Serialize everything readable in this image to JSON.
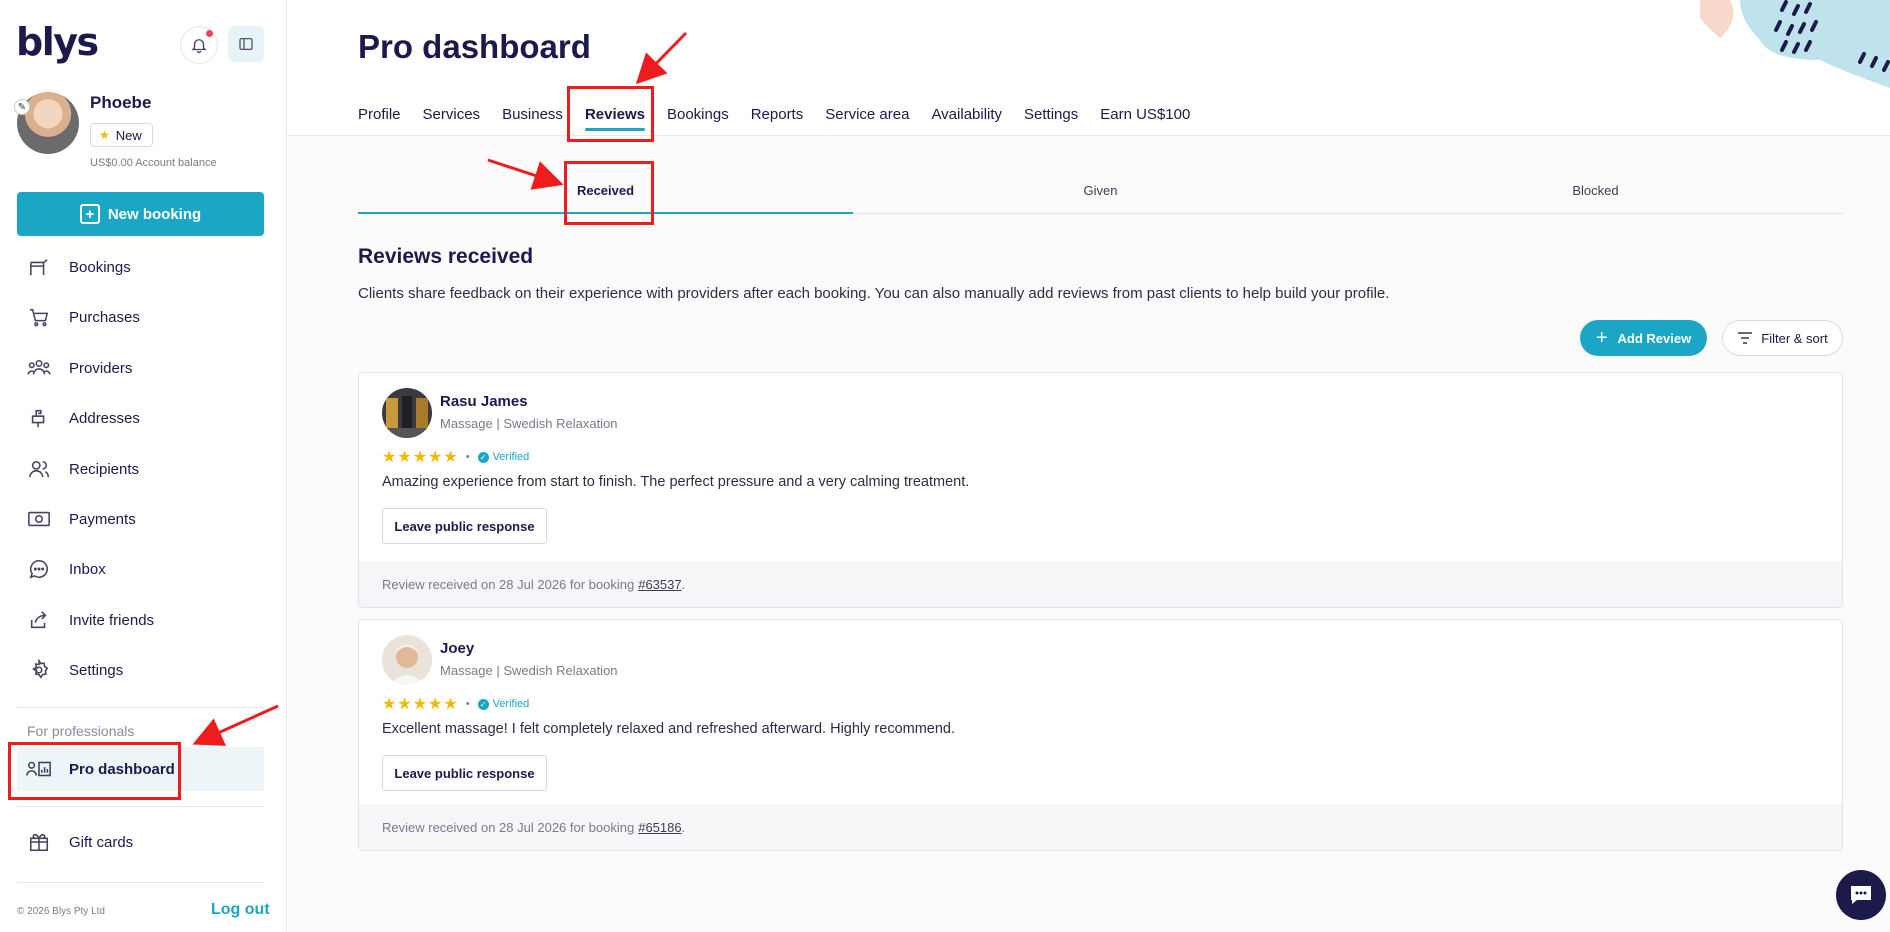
{
  "brand": {
    "logo_text": "blys",
    "accent_color": "#1aa6c4",
    "navy_color": "#1b1a4a"
  },
  "header_actions": {
    "notifications_icon": "bell-icon",
    "collapse_icon": "sidebar-toggle-icon"
  },
  "user": {
    "name": "Phoebe",
    "tier": "New",
    "balance": "US$0.00 Account balance"
  },
  "sidebar": {
    "new_booking_label": "New booking",
    "items": [
      {
        "label": "Bookings",
        "icon": "bookings-icon"
      },
      {
        "label": "Purchases",
        "icon": "cart-icon"
      },
      {
        "label": "Providers",
        "icon": "providers-icon"
      },
      {
        "label": "Addresses",
        "icon": "mailbox-icon"
      },
      {
        "label": "Recipients",
        "icon": "people-icon"
      },
      {
        "label": "Payments",
        "icon": "money-icon"
      },
      {
        "label": "Inbox",
        "icon": "chat-icon"
      },
      {
        "label": "Invite friends",
        "icon": "share-icon"
      },
      {
        "label": "Settings",
        "icon": "gear-icon"
      }
    ],
    "section_label": "For professionals",
    "pro_dashboard_label": "Pro dashboard",
    "gift_cards_label": "Gift cards",
    "copyright": "© 2026 Blys Pty Ltd",
    "logout_label": "Log out"
  },
  "main": {
    "title": "Pro dashboard",
    "tabs": [
      "Profile",
      "Services",
      "Business",
      "Reviews",
      "Bookings",
      "Reports",
      "Service area",
      "Availability",
      "Settings",
      "Earn US$100"
    ],
    "active_tab": "Reviews",
    "sub_tabs": [
      "Received",
      "Given",
      "Blocked"
    ],
    "active_sub_tab": "Received",
    "section_title": "Reviews received",
    "section_desc": "Clients share feedback on their experience with providers after each booking. You can also manually add reviews from past clients to help build your profile.",
    "add_review_label": "Add Review",
    "filter_label": "Filter & sort"
  },
  "reviews": [
    {
      "name": "Rasu James",
      "service": "Massage | Swedish Relaxation",
      "rating": 5,
      "verified_label": "Verified",
      "text": "Amazing experience from start to finish. The perfect pressure and a very calming treatment.",
      "respond_label": "Leave public response",
      "footer_prefix": "Review received on 28 Jul 2026 for booking",
      "booking_ref": "#63537"
    },
    {
      "name": "Joey",
      "service": "Massage | Swedish Relaxation",
      "rating": 5,
      "verified_label": "Verified",
      "text": "Excellent massage! I felt completely relaxed and refreshed afterward. Highly recommend.",
      "respond_label": "Leave public response",
      "footer_prefix": "Review received on 28 Jul 2026 for booking",
      "booking_ref": "#65186"
    }
  ],
  "chat_icon": "chat-bubble-icon",
  "annotation_color": "#ee1c1c"
}
